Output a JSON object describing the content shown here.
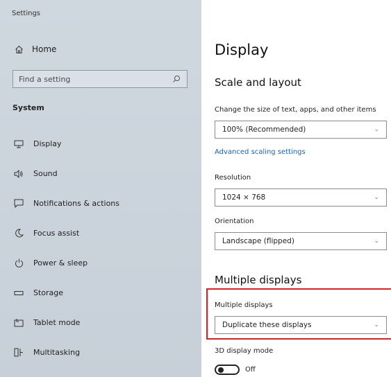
{
  "window": {
    "title": "Settings"
  },
  "sidebar": {
    "home_label": "Home",
    "search_placeholder": "Find a setting",
    "section_heading": "System",
    "items": [
      {
        "label": "Display",
        "icon": "monitor-icon"
      },
      {
        "label": "Sound",
        "icon": "speaker-icon"
      },
      {
        "label": "Notifications & actions",
        "icon": "notification-icon"
      },
      {
        "label": "Focus assist",
        "icon": "moon-icon"
      },
      {
        "label": "Power & sleep",
        "icon": "power-icon"
      },
      {
        "label": "Storage",
        "icon": "storage-icon"
      },
      {
        "label": "Tablet mode",
        "icon": "tablet-icon"
      },
      {
        "label": "Multitasking",
        "icon": "multitasking-icon"
      }
    ]
  },
  "main": {
    "title": "Display",
    "scale_layout": {
      "heading": "Scale and layout",
      "scale_label": "Change the size of text, apps, and other items",
      "scale_value": "100% (Recommended)",
      "advanced_link": "Advanced scaling settings",
      "resolution_label": "Resolution",
      "resolution_value": "1024 × 768",
      "orientation_label": "Orientation",
      "orientation_value": "Landscape (flipped)"
    },
    "multiple_displays": {
      "heading": "Multiple displays",
      "label": "Multiple displays",
      "value": "Duplicate these displays"
    },
    "three_d": {
      "label": "3D display mode",
      "toggle_state": "Off"
    }
  },
  "colors": {
    "accent_link": "#1f5fa8",
    "highlight_box": "#d41f26",
    "sidebar_bg": "#cfd7df"
  }
}
